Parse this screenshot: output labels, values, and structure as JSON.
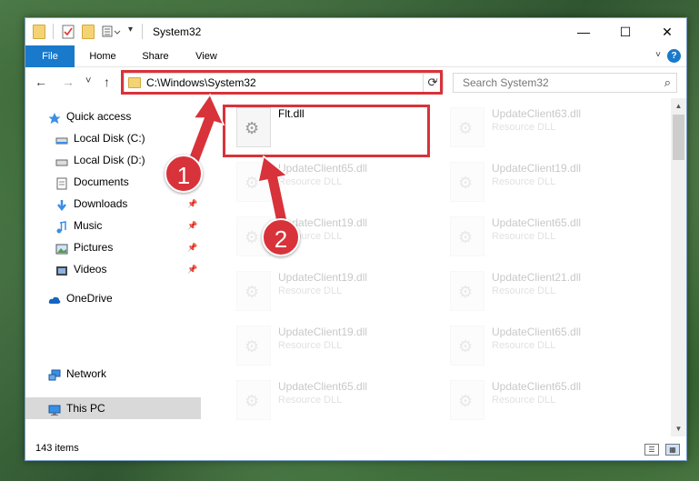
{
  "window": {
    "title": "System32",
    "controls": {
      "minimize": "—",
      "maximize": "☐",
      "close": "✕"
    }
  },
  "ribbon": {
    "tabs": [
      {
        "label": "File"
      },
      {
        "label": "Home"
      },
      {
        "label": "Share"
      },
      {
        "label": "View"
      }
    ],
    "help": "?"
  },
  "navigation": {
    "back_icon": "←",
    "forward_icon": "→",
    "recent_icon": "˅",
    "up_icon": "↑",
    "address": "C:\\Windows\\System32",
    "search_placeholder": "Search System32"
  },
  "sidebar": {
    "items": [
      {
        "label": "Quick access",
        "icon": "star-icon",
        "pinned": false
      },
      {
        "label": "Local Disk (C:)",
        "icon": "drive-icon",
        "pinned": false
      },
      {
        "label": "Local Disk (D:)",
        "icon": "drive-icon",
        "pinned": false
      },
      {
        "label": "Documents",
        "icon": "documents-icon",
        "pinned": true
      },
      {
        "label": "Downloads",
        "icon": "download-icon",
        "pinned": true
      },
      {
        "label": "Music",
        "icon": "music-icon",
        "pinned": true
      },
      {
        "label": "Pictures",
        "icon": "pictures-icon",
        "pinned": true
      },
      {
        "label": "Videos",
        "icon": "videos-icon",
        "pinned": true
      },
      {
        "label": "OneDrive",
        "icon": "cloud-icon",
        "pinned": false
      },
      {
        "label": "This PC",
        "icon": "computer-icon",
        "pinned": false,
        "selected": true
      },
      {
        "label": "Network",
        "icon": "network-icon",
        "pinned": false
      }
    ]
  },
  "files": [
    {
      "name": "Flt.dll",
      "type": "",
      "highlighted": true
    },
    {
      "name": "UpdateClient63.dll",
      "type": "Resource DLL"
    },
    {
      "name": "UpdateClient65.dll",
      "type": "Resource DLL"
    },
    {
      "name": "UpdateClient19.dll",
      "type": "Resource DLL"
    },
    {
      "name": "UpdateClient19.dll",
      "type": "Resource DLL"
    },
    {
      "name": "UpdateClient65.dll",
      "type": "Resource DLL"
    },
    {
      "name": "UpdateClient19.dll",
      "type": "Resource DLL"
    },
    {
      "name": "UpdateClient21.dll",
      "type": "Resource DLL"
    },
    {
      "name": "UpdateClient19.dll",
      "type": "Resource DLL"
    },
    {
      "name": "UpdateClient65.dll",
      "type": "Resource DLL"
    },
    {
      "name": "UpdateClient65.dll",
      "type": "Resource DLL"
    },
    {
      "name": "UpdateClient65.dll",
      "type": "Resource DLL"
    }
  ],
  "status": {
    "item_count": "143 items"
  },
  "annotations": {
    "badge1": "1",
    "badge2": "2",
    "color": "#d8333a"
  }
}
